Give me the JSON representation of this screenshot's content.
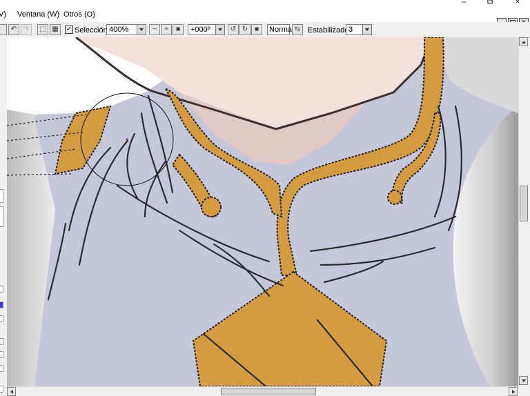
{
  "window": {
    "minimize_glyph": "–",
    "restore_glyph": "⧉",
    "close_glyph": "×"
  },
  "menu": {
    "items": [
      {
        "label": "V)"
      },
      {
        "label": "Ventana (W)"
      },
      {
        "label": "Otros (O)"
      }
    ]
  },
  "toolbar": {
    "selection_label": "Selección",
    "selection_checked": true,
    "zoom": "400%",
    "rotation": "+000º",
    "blend_mode": "Normal",
    "stabilizer_label": "Estabilizador",
    "stabilizer_value": "3"
  },
  "colors": {
    "gold": "#d49b40",
    "jacket": "#c5c8d8",
    "skin": "#f2e2dd",
    "collar": "#ffffff",
    "line": "#2c2c30",
    "hair": "#d8d8d8"
  }
}
